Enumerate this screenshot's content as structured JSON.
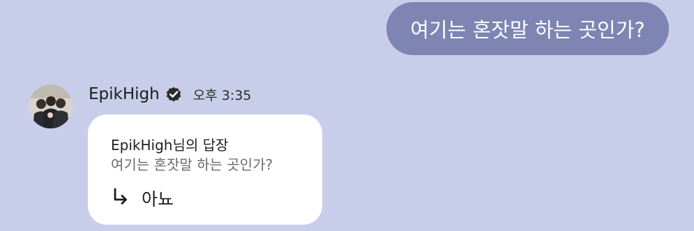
{
  "sent_message": {
    "text": "여기는 혼잣말 하는 곳인가?"
  },
  "incoming": {
    "sender_name": "EpikHigh",
    "verified_icon": "verified-badge-icon",
    "time": "오후 3:35",
    "reply_card": {
      "header": "EpikHigh님의 답장",
      "quoted_text": "여기는 혼잣말 하는 곳인가?",
      "reply_icon": "reply-arrow-icon",
      "reply_text": "아뇨"
    }
  },
  "colors": {
    "background": "#c8cde9",
    "sent_bubble": "#7e85b3",
    "card": "#ffffff"
  }
}
